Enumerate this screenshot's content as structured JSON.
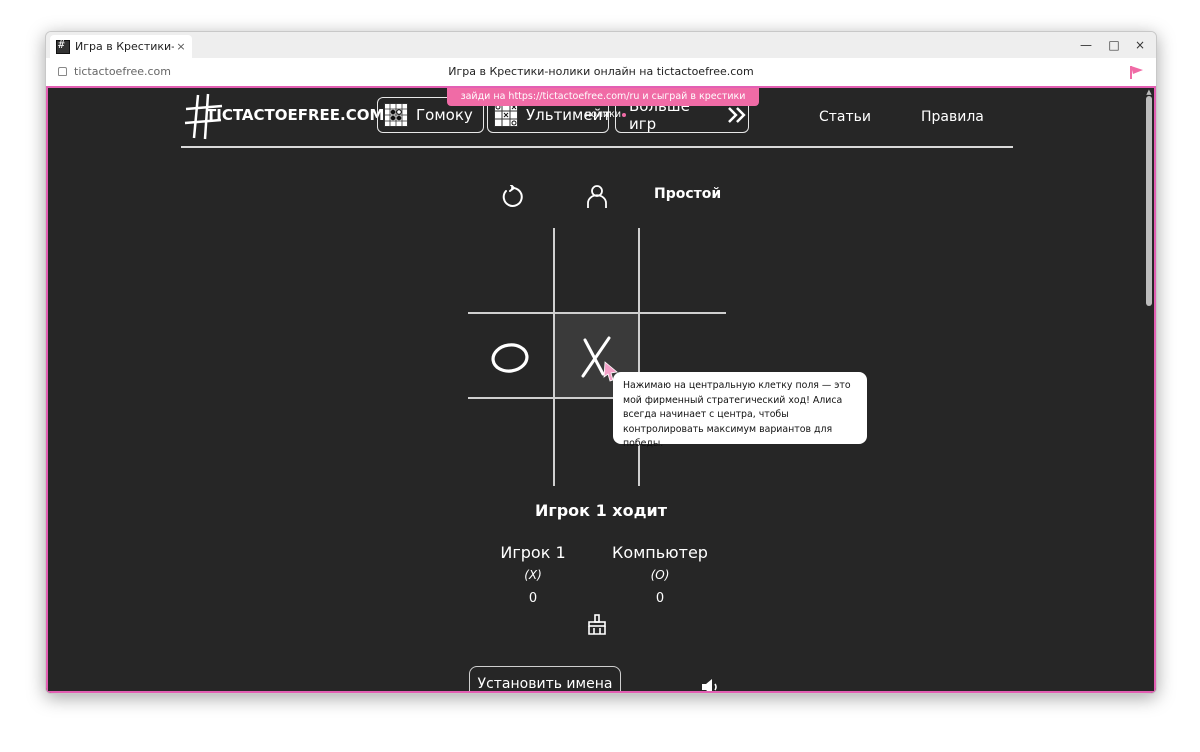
{
  "browser": {
    "tab_title": "Игра в Крестики-ноли…",
    "tab_close": "×",
    "url": "tictactoefree.com",
    "page_title": "Игра в Крестики-нолики онлайн на tictactoefree.com",
    "minimize": "—",
    "maximize": "□",
    "close": "×"
  },
  "banner": {
    "text": "зайди на https://tictactoefree.com/ru и сыграй в крестики нолики"
  },
  "header": {
    "logo_text": "TICTACTOEFREE.COM",
    "game_buttons": [
      {
        "label": "Гомоку",
        "icon": "gomoku-board-icon"
      },
      {
        "label": "Ультимейт",
        "icon": "ultimate-board-icon"
      },
      {
        "label": "Больше игр",
        "icon": "double-chevron-right-icon"
      }
    ],
    "links": [
      "Статьи",
      "Правила"
    ]
  },
  "controls": {
    "restart_icon": "restart-icon",
    "mode_icon": "user-icon",
    "difficulty": "Простой"
  },
  "board": {
    "cells": [
      "",
      "",
      "",
      "O",
      "X",
      "",
      "",
      "",
      ""
    ],
    "highlight_cell": 4
  },
  "tooltip": {
    "text": "Нажимаю на центральную клетку поля — это мой фирменный стратегический ход! Алиса всегда начинает с центра, чтобы контролировать максимум вариантов для победы."
  },
  "status": "Игрок 1 ходит",
  "players": [
    {
      "name": "Игрок 1",
      "mark": "(X)",
      "score": "0"
    },
    {
      "name": "Компьютер",
      "mark": "(O)",
      "score": "0"
    }
  ],
  "footer": {
    "set_names_label": "Установить имена",
    "broom_icon": "broom-icon",
    "sound_icon": "speaker-icon"
  },
  "colors": {
    "background": "#262626",
    "accent_pink": "#f06ba6",
    "viewport_border": "#e35fb3",
    "foreground": "#ffffff"
  }
}
